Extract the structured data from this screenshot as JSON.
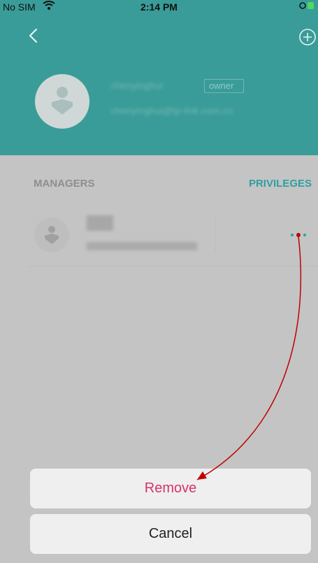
{
  "status_bar": {
    "carrier": "No SIM",
    "time": "2:14 PM"
  },
  "owner": {
    "name": "chenyinghui",
    "badge": "owner",
    "email": "chenyinghui@tp-link.com.cn"
  },
  "managers": {
    "title": "MANAGERS",
    "privileges_label": "PRIVILEGES"
  },
  "action_sheet": {
    "remove_label": "Remove",
    "cancel_label": "Cancel"
  },
  "colors": {
    "header": "#3a9c98",
    "accent": "#2f9fa0",
    "destructive": "#d6336c",
    "annotation": "#c00000"
  },
  "icons": {
    "back": "chevron-left-icon",
    "add": "plus-circle-icon",
    "more": "more-dots-icon"
  }
}
